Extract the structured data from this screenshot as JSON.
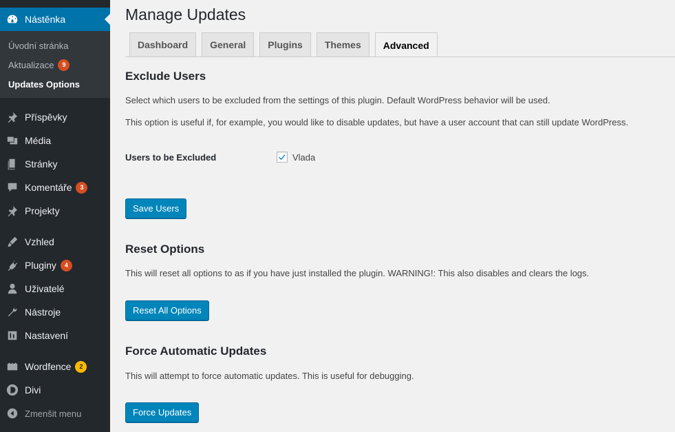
{
  "sidebar": {
    "dashboard": {
      "label": "Nástěnka",
      "icon": "dashboard-icon"
    },
    "submenu": [
      {
        "label": "Úvodní stránka"
      },
      {
        "label": "Aktualizace",
        "badge": "9"
      },
      {
        "label": "Updates Options"
      }
    ],
    "items": [
      {
        "label": "Příspěvky",
        "icon": "pin-icon"
      },
      {
        "label": "Média",
        "icon": "media-icon"
      },
      {
        "label": "Stránky",
        "icon": "pages-icon"
      },
      {
        "label": "Komentáře",
        "icon": "comments-icon",
        "badge": "3"
      },
      {
        "label": "Projekty",
        "icon": "pin-icon"
      },
      {
        "label": "Vzhled",
        "icon": "appearance-icon"
      },
      {
        "label": "Pluginy",
        "icon": "plugins-icon",
        "badge": "4"
      },
      {
        "label": "Uživatelé",
        "icon": "users-icon"
      },
      {
        "label": "Nástroje",
        "icon": "tools-icon"
      },
      {
        "label": "Nastavení",
        "icon": "settings-icon"
      },
      {
        "label": "Wordfence",
        "icon": "wordfence-icon",
        "badge": "2"
      },
      {
        "label": "Divi",
        "icon": "divi-icon"
      },
      {
        "label": "Zmenšit menu",
        "icon": "collapse-icon"
      }
    ]
  },
  "page": {
    "title": "Manage Updates",
    "tabs": [
      "Dashboard",
      "General",
      "Plugins",
      "Themes",
      "Advanced"
    ],
    "active_tab": "Advanced"
  },
  "exclude_users": {
    "heading": "Exclude Users",
    "desc1": "Select which users to be excluded from the settings of this plugin. Default WordPress behavior will be used.",
    "desc2": "This option is useful if, for example, you would like to disable updates, but have a user account that can still update WordPress.",
    "field_label": "Users to be Excluded",
    "user": "Vlada",
    "checked": true,
    "button": "Save Users"
  },
  "reset_options": {
    "heading": "Reset Options",
    "desc": "This will reset all options to as if you have just installed the plugin. WARNING!: This also disables and clears the logs.",
    "button": "Reset All Options"
  },
  "force_updates": {
    "heading": "Force Automatic Updates",
    "desc": "This will attempt to force automatic updates. This is useful for debugging.",
    "button": "Force Updates"
  },
  "colors": {
    "sidebar_bg": "#23282d",
    "accent": "#0073aa",
    "badge": "#d54e21",
    "badge_yellow": "#ffb900",
    "button": "#0085ba"
  }
}
